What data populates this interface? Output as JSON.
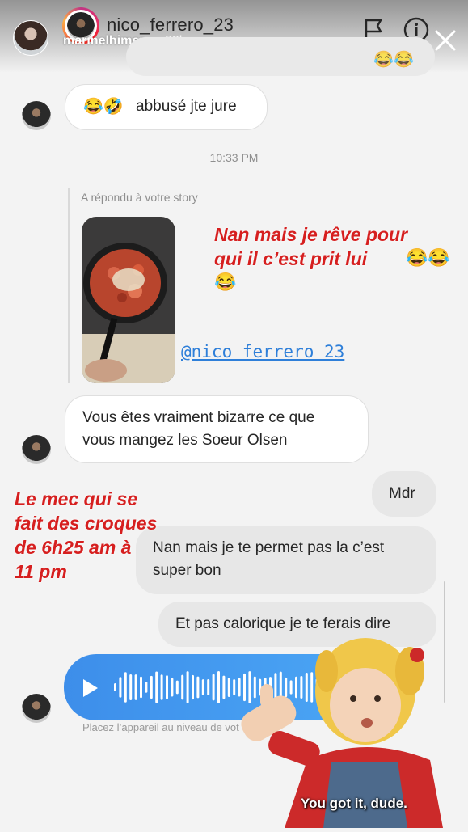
{
  "header": {
    "username": "nico_ferrero_23",
    "story_owner": "marinelhimer",
    "time_ago": "22h",
    "icons": [
      "flag-icon",
      "info-icon",
      "close-icon"
    ]
  },
  "chat": {
    "msg_1": "abbusé jte jure",
    "msg_1_emoji": "😂🤣",
    "timestamp": "10:33 PM",
    "reply_label": "A répondu à votre story",
    "story_mention": "@nico_ferrero_23",
    "msg_2_line1": "Vous êtes vraiment bizarre ce que",
    "msg_2_line2": "vous mangez les Soeur Olsen",
    "msg_3": "Mdr",
    "msg_4_line1": "Nan mais je te permet pas la c’est",
    "msg_4_line2": "super bon",
    "msg_5": "Et pas calorique je te ferais dire",
    "voice_hint": "Placez l’appareil au niveau de vot"
  },
  "overlays": {
    "red_top_line1": "Nan mais je rêve pour",
    "red_top_line2": "qui il c’est prit lui",
    "red_top_emoji_1": "😂😂",
    "red_top_emoji_2": "😂",
    "red_left_line1": "Le mec qui se",
    "red_left_line2": "fait des croques",
    "red_left_line3": "de 6h25 am à",
    "red_left_line4": "11 pm",
    "sticker_caption": "You got it, dude."
  },
  "colors": {
    "overlay_red": "#d61f1f",
    "voice_blue": "#3d8eea",
    "mention_blue": "#2e7fd9"
  }
}
